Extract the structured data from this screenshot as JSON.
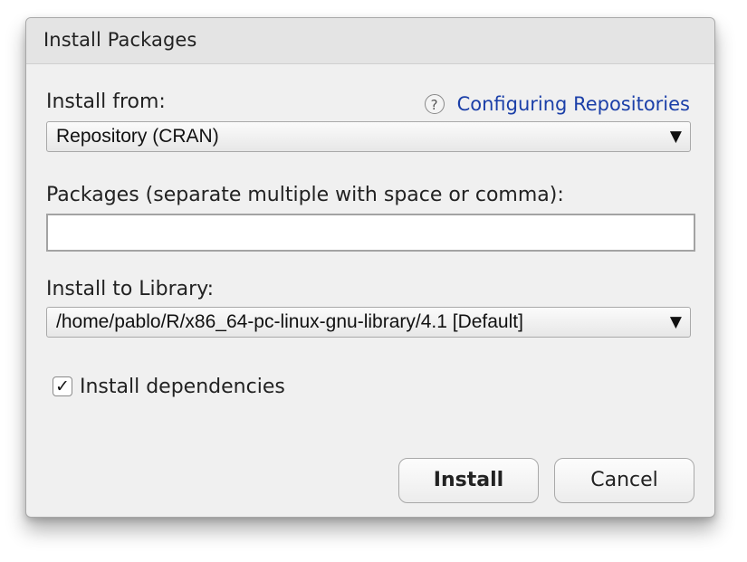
{
  "dialog": {
    "title": "Install Packages"
  },
  "install_from": {
    "label": "Install from:",
    "help_icon": "question-circle-icon",
    "help_glyph": "?",
    "help_link": "Configuring Repositories",
    "selected": "Repository (CRAN)",
    "arrow": "▼"
  },
  "packages": {
    "label": "Packages (separate multiple with space or comma):",
    "value": "",
    "placeholder": ""
  },
  "library": {
    "label": "Install to Library:",
    "selected": "/home/pablo/R/x86_64-pc-linux-gnu-library/4.1 [Default]",
    "arrow": "▼"
  },
  "dependencies": {
    "label": "Install dependencies",
    "checked": true,
    "check_glyph": "✓"
  },
  "buttons": {
    "install": "Install",
    "cancel": "Cancel"
  },
  "colors": {
    "link": "#1b3fa8",
    "dialog_bg": "#f0f0f0",
    "titlebar_bg": "#e4e4e4"
  }
}
